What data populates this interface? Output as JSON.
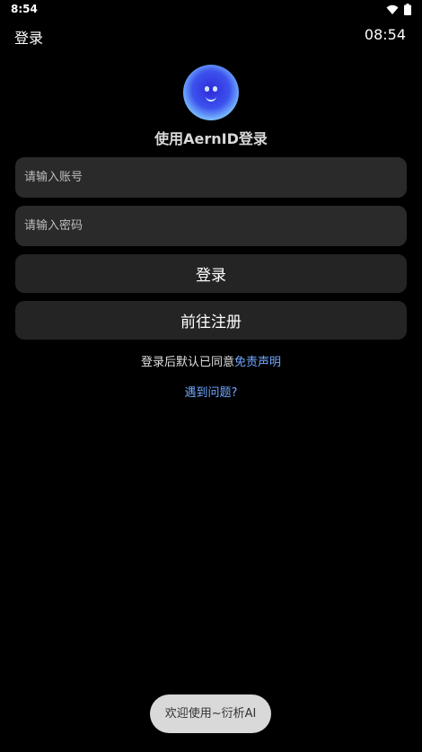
{
  "status_bar": {
    "time": "8:54",
    "icons": [
      "wifi-icon",
      "battery-icon"
    ]
  },
  "app_bar": {
    "title": "登录",
    "clock": "08:54"
  },
  "login": {
    "heading": "使用AernID登录",
    "account_placeholder": "请输入账号",
    "password_placeholder": "请输入密码",
    "login_button": "登录",
    "register_button": "前往注册",
    "agree_text": "登录后默认已同意",
    "disclaimer_link": "免责声明",
    "help_link": "遇到问题?"
  },
  "toast": {
    "text": "欢迎使用~衍析AI"
  },
  "colors": {
    "background": "#000000",
    "field": "#2a2a2a",
    "link": "#6fa8ff",
    "toast": "#d9d9d9"
  }
}
